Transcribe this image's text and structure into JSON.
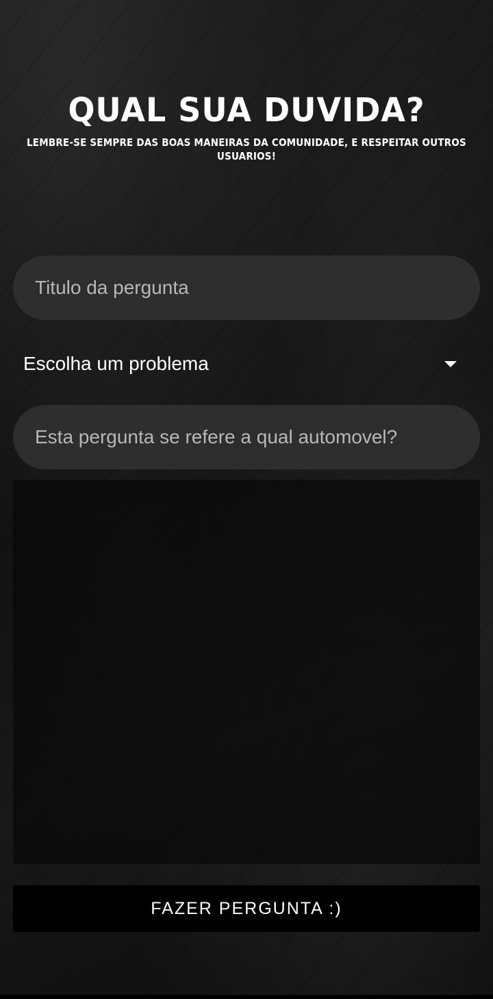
{
  "header": {
    "title": "Qual sua duvida?",
    "subtitle": "Lembre-se sempre das boas maneiras da comunidade, e respeitar outros usuarios!"
  },
  "form": {
    "question_title": {
      "value": "",
      "placeholder": "Titulo da pergunta"
    },
    "problem_select": {
      "selected": "Escolha um problema",
      "icon": "dropdown-caret-icon"
    },
    "vehicle": {
      "value": "",
      "placeholder": "Esta pergunta se refere a qual automovel?"
    },
    "description": {
      "value": "",
      "placeholder": ""
    },
    "submit_label": "FAZER PERGUNTA :)"
  },
  "colors": {
    "background": "#121212",
    "field_background": "#303030",
    "button_background": "#000000",
    "text": "#ffffff",
    "placeholder": "#b8b8b8"
  }
}
